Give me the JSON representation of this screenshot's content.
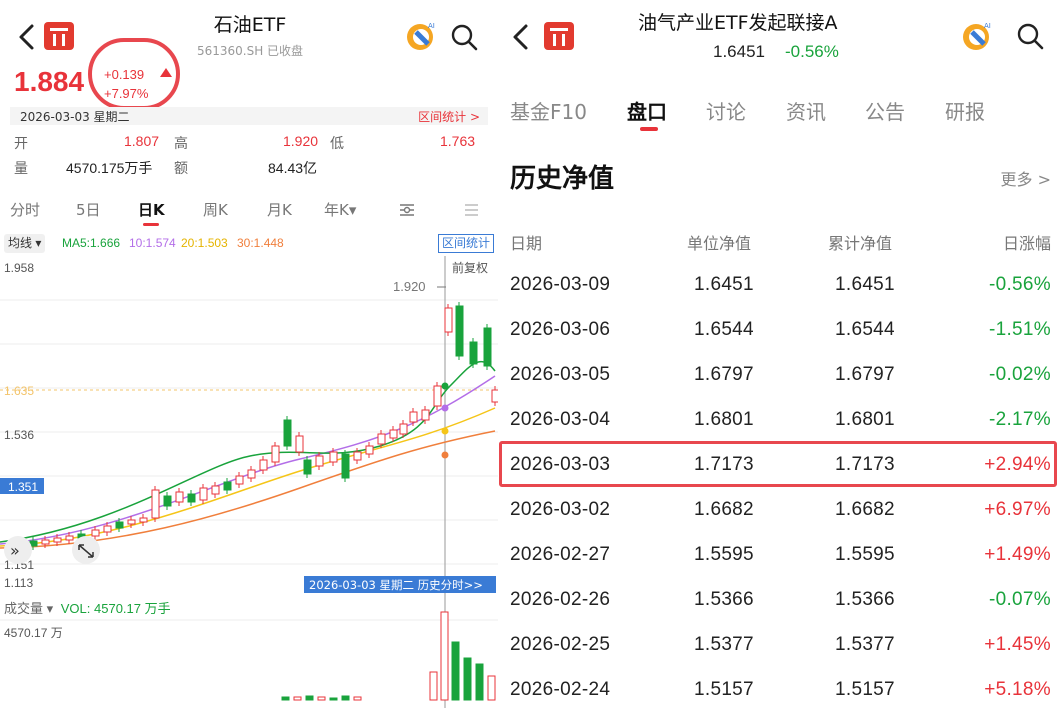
{
  "left": {
    "title": "石油ETF",
    "code_status": "561360.SH  已收盘",
    "price": "1.884",
    "change_abs": "+0.139",
    "change_pct": "+7.97%",
    "date": "2026-03-03 星期二",
    "range_stats": "区间统计 >",
    "stats": {
      "open_label": "开",
      "open": "1.807",
      "high_label": "高",
      "high": "1.920",
      "low_label": "低",
      "low": "1.763",
      "vol_label": "量",
      "vol": "4570.175万手",
      "amt_label": "额",
      "amt": "84.43亿"
    },
    "tabs": [
      "分时",
      "5日",
      "日K",
      "周K",
      "月K",
      "年K▾",
      "",
      ""
    ],
    "active_tab": "日K",
    "ma": {
      "select": "均线 ▾",
      "ma5": "MA5:1.666",
      "ma10": "10:1.574",
      "ma20": "20:1.503",
      "ma30": "30:1.448",
      "range_btn": "区间统计"
    },
    "chart": {
      "y_labels": [
        "1.958",
        "1.635",
        "1.536",
        "1.351",
        "1.151",
        "1.113"
      ],
      "fq": "前复权",
      "high_mark": "1.920",
      "history_tip": "2026-03-03 星期二  历史分时>>"
    },
    "volume": {
      "label": "成交量 ▾",
      "vol": "VOL: 4570.17 万手",
      "max": "4570.17 万"
    },
    "colors": {
      "up": "#e8333a",
      "down": "#19a33c",
      "ma5": "#19a33c",
      "ma10": "#b36ee8",
      "ma20": "#f5c518",
      "ma30": "#f07f3c"
    }
  },
  "right": {
    "title": "油气产业ETF发起联接A",
    "price": "1.6451",
    "change": "-0.56%",
    "tabs": [
      "基金F10",
      "盘口",
      "讨论",
      "资讯",
      "公告",
      "研报"
    ],
    "active_tab": "盘口",
    "section_title": "历史净值",
    "more": "更多 >",
    "headers": [
      "日期",
      "单位净值",
      "累计净值",
      "日涨幅"
    ],
    "rows": [
      {
        "date": "2026-03-09",
        "nav": "1.6451",
        "acc": "1.6451",
        "chg": "-0.56%"
      },
      {
        "date": "2026-03-06",
        "nav": "1.6544",
        "acc": "1.6544",
        "chg": "-1.51%"
      },
      {
        "date": "2026-03-05",
        "nav": "1.6797",
        "acc": "1.6797",
        "chg": "-0.02%"
      },
      {
        "date": "2026-03-04",
        "nav": "1.6801",
        "acc": "1.6801",
        "chg": "-2.17%"
      },
      {
        "date": "2026-03-03",
        "nav": "1.7173",
        "acc": "1.7173",
        "chg": "+2.94%"
      },
      {
        "date": "2026-03-02",
        "nav": "1.6682",
        "acc": "1.6682",
        "chg": "+6.97%"
      },
      {
        "date": "2026-02-27",
        "nav": "1.5595",
        "acc": "1.5595",
        "chg": "+1.49%"
      },
      {
        "date": "2026-02-26",
        "nav": "1.5366",
        "acc": "1.5366",
        "chg": "-0.07%"
      },
      {
        "date": "2026-02-25",
        "nav": "1.5377",
        "acc": "1.5377",
        "chg": "+1.45%"
      },
      {
        "date": "2026-02-24",
        "nav": "1.5157",
        "acc": "1.5157",
        "chg": "+5.18%"
      }
    ],
    "highlight_date": "2026-03-03"
  }
}
